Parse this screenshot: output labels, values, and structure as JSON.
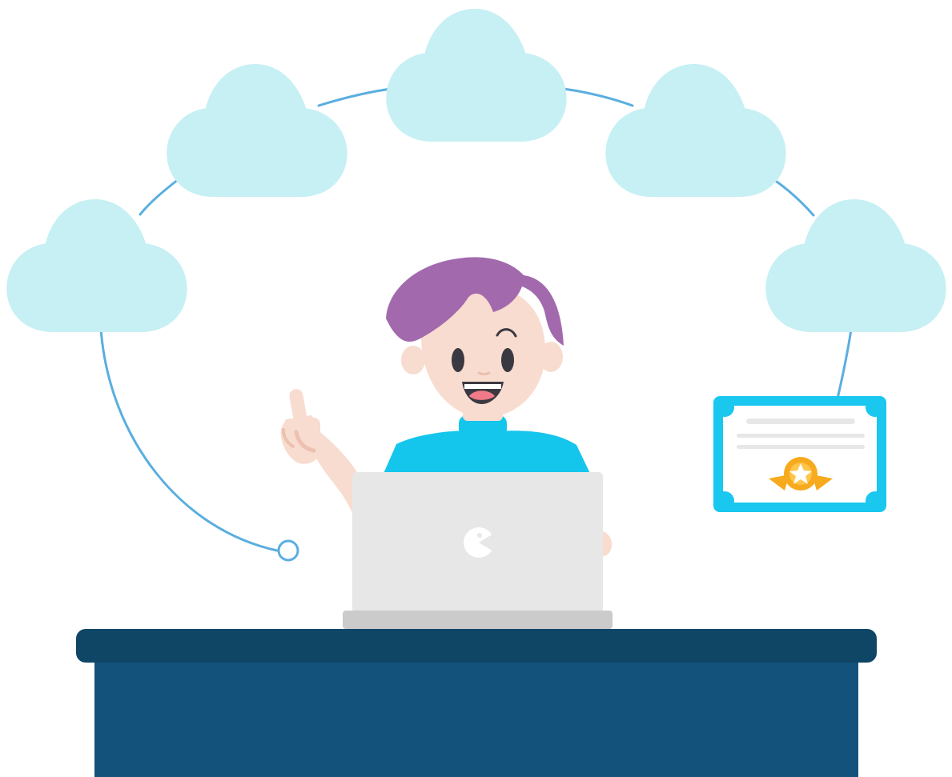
{
  "illustration": {
    "elements": [
      "cloud-icon",
      "connection-path",
      "path-end-node-icon",
      "certificate-icon",
      "award-ribbon-icon",
      "star-icon",
      "student-character",
      "laptop-icon",
      "desk"
    ],
    "palette": {
      "cloud": "#c6f0f4",
      "path": "#5aaee0",
      "hair": "#a26aad",
      "skin": "#f8dccf",
      "shirt": "#14c6eb",
      "laptop": "#e7e7e7",
      "laptop_base": "#cbcbcb",
      "desk_top": "#0f4565",
      "desk_front": "#12527b",
      "certificate_border": "#19c7ef",
      "medal": "#f7aa1d"
    }
  }
}
